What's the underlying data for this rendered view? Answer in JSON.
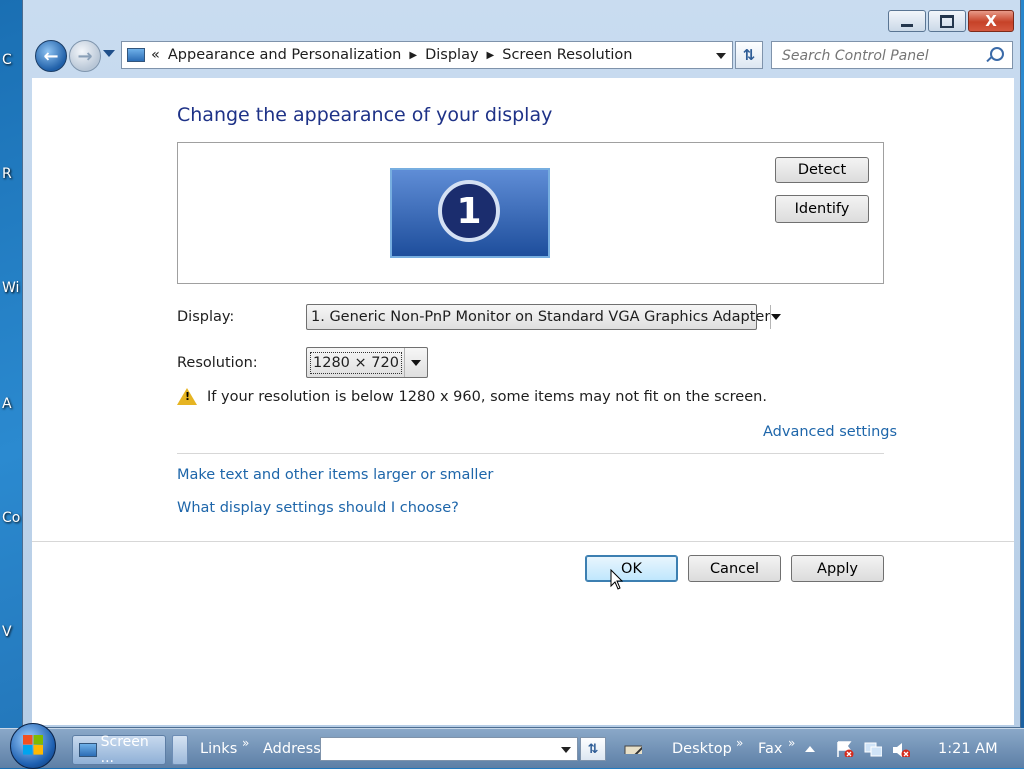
{
  "desktop": {
    "icon_labels": [
      "C",
      "R",
      "Wi",
      "A",
      "Co",
      "V"
    ]
  },
  "window": {
    "caption_buttons": {
      "minimize": "minimize-icon",
      "maximize": "maximize-icon",
      "close": "X"
    },
    "breadcrumb": {
      "overflow": "«",
      "items": [
        "Appearance and Personalization",
        "Display",
        "Screen Resolution"
      ]
    },
    "search": {
      "placeholder": "Search Control Panel"
    },
    "title": "Change the appearance of your display",
    "preview": {
      "monitor_number": "1",
      "detect_label": "Detect",
      "identify_label": "Identify"
    },
    "display": {
      "label": "Display:",
      "value": "1. Generic Non-PnP Monitor on Standard VGA Graphics Adapter"
    },
    "resolution": {
      "label": "Resolution:",
      "value": "1280 × 720"
    },
    "warning": "If your resolution is below 1280 x 960, some items may not fit on the screen.",
    "advanced_link": "Advanced settings",
    "links": [
      "Make text and other items larger or smaller",
      "What display settings should I choose?"
    ],
    "buttons": {
      "ok": "OK",
      "cancel": "Cancel",
      "apply": "Apply"
    }
  },
  "taskbar": {
    "task_label": "Screen ...",
    "links_label": "Links",
    "address_label": "Address",
    "desktop_label": "Desktop",
    "fax_label": "Fax",
    "chevron": "»",
    "clock": "1:21 AM"
  },
  "colors": {
    "accent_title": "#1e3287",
    "link": "#1e66aa",
    "warning_icon": "#e6b422"
  }
}
